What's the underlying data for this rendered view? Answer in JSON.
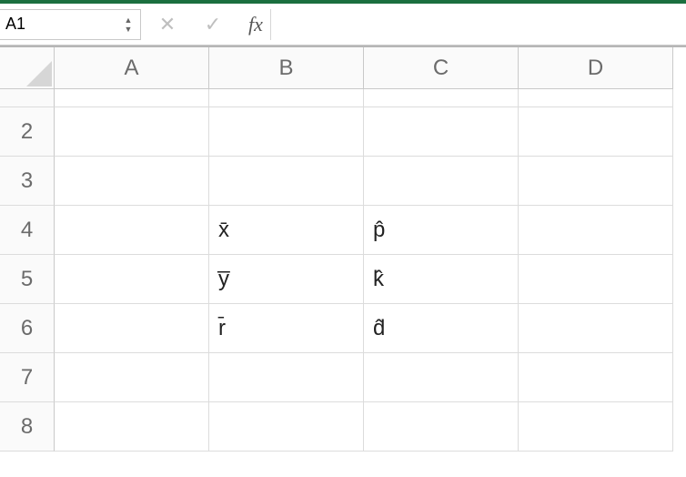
{
  "formula_bar": {
    "name_box_value": "A1",
    "cancel_glyph": "✕",
    "accept_glyph": "✓",
    "fx_label": "fx",
    "formula_value": ""
  },
  "grid": {
    "columns": [
      "A",
      "B",
      "C",
      "D"
    ],
    "rows": [
      {
        "num": "",
        "short": true,
        "cells": [
          "",
          "",
          "",
          ""
        ]
      },
      {
        "num": "2",
        "cells": [
          "",
          "",
          "",
          ""
        ]
      },
      {
        "num": "3",
        "cells": [
          "",
          "",
          "",
          ""
        ]
      },
      {
        "num": "4",
        "cells": [
          "",
          "x̄",
          "p̂",
          ""
        ]
      },
      {
        "num": "5",
        "cells": [
          "",
          "y̅",
          "k̂",
          ""
        ]
      },
      {
        "num": "6",
        "cells": [
          "",
          "r̄",
          "d̂",
          ""
        ]
      },
      {
        "num": "7",
        "cells": [
          "",
          "",
          "",
          ""
        ]
      },
      {
        "num": "8",
        "cells": [
          "",
          "",
          "",
          ""
        ]
      }
    ]
  }
}
